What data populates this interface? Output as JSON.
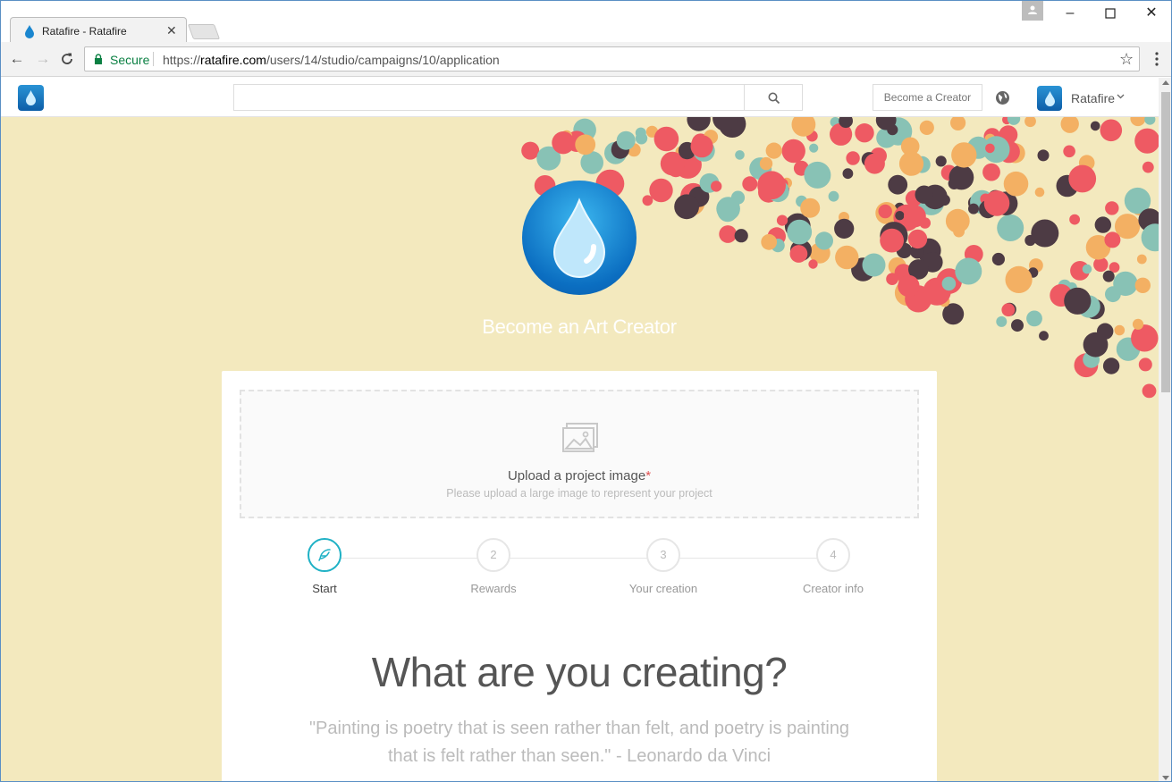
{
  "browser": {
    "tab_title": "Ratafire - Ratafire",
    "secure_label": "Secure",
    "url_scheme": "https://",
    "url_host": "ratafire.com",
    "url_path": "/users/14/studio/campaigns/10/application"
  },
  "site_nav": {
    "search_value": "",
    "become_creator_label": "Become a Creator",
    "user_name": "Ratafire"
  },
  "hero": {
    "title": "Become an Art Creator"
  },
  "upload": {
    "title": "Upload a project image",
    "required_mark": "*",
    "subtitle": "Please upload a large image to represent your project"
  },
  "steps": [
    {
      "number": "",
      "label": "Start",
      "active": true
    },
    {
      "number": "2",
      "label": "Rewards",
      "active": false
    },
    {
      "number": "3",
      "label": "Your creation",
      "active": false
    },
    {
      "number": "4",
      "label": "Creator info",
      "active": false
    }
  ],
  "main": {
    "heading": "What are you creating?",
    "quote": "\"Painting is poetry that is seen rather than felt, and poetry is painting that is felt rather than seen.\" - Leonardo da Vinci"
  },
  "colors": {
    "page_background": "#f3e9be",
    "accent": "#1fb1c5",
    "dot_coral": "#ee5a63",
    "dot_orange": "#f3b063",
    "dot_teal": "#88c2b5",
    "dot_dark": "#4d3b44"
  }
}
